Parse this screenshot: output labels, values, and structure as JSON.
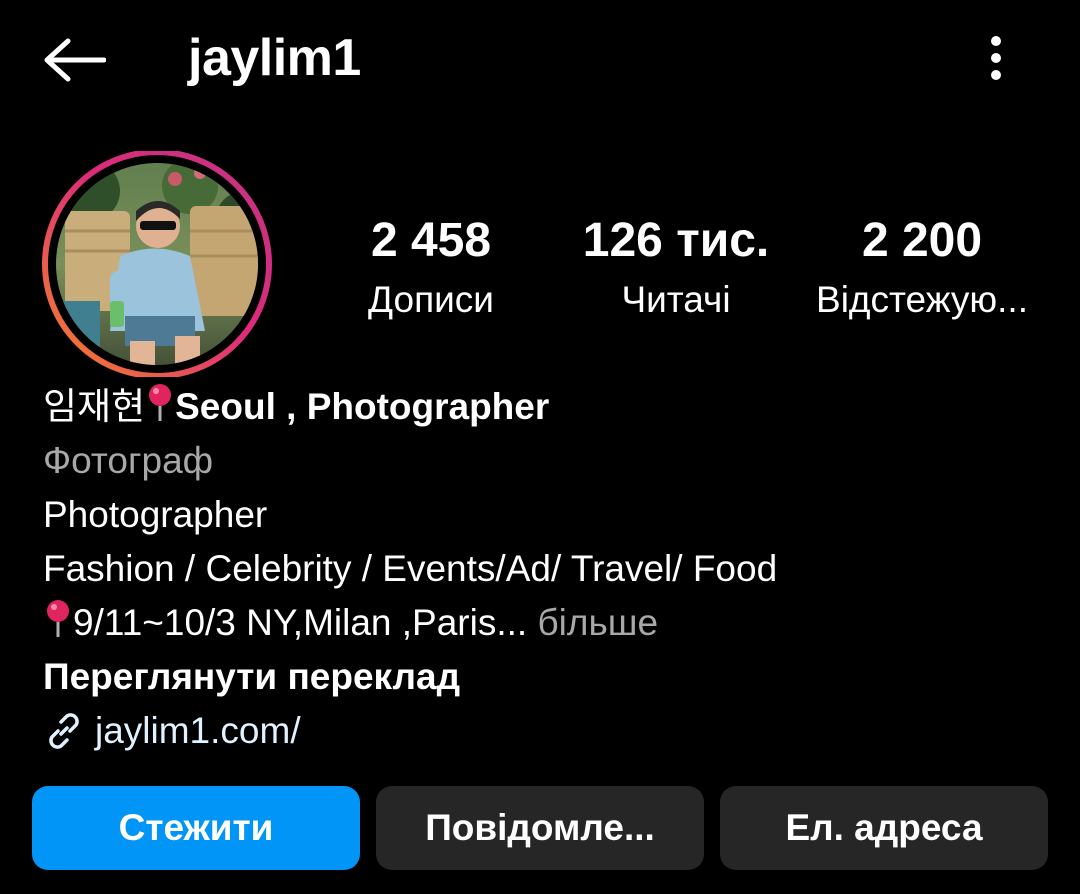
{
  "header": {
    "back_icon": "arrow-left-icon",
    "username": "jaylim1",
    "more_icon": "more-vertical-icon"
  },
  "profile": {
    "avatar_ring_colors": [
      "#f58529",
      "#dd2a7b",
      "#8134af"
    ],
    "stats": [
      {
        "value": "2 458",
        "label": "Дописи"
      },
      {
        "value": "126 тис.",
        "label": "Читачі"
      },
      {
        "value": "2 200",
        "label": "Відстежую..."
      }
    ]
  },
  "bio": {
    "name_korean": "임재현",
    "name_rest": "Seoul , Photographer",
    "category": "Фотограф",
    "line1": "Photographer",
    "line2": "Fashion / Celebrity / Events/Ad/ Travel/ Food",
    "line3": "9/11~10/3 NY,Milan ,Paris...",
    "more_label": "більше",
    "translate_label": "Переглянути переклад",
    "link_icon": "link-icon",
    "link_text": "jaylim1.com/"
  },
  "actions": {
    "follow_label": "Стежити",
    "message_label": "Повідомле...",
    "email_label": "Ел. адреса"
  },
  "colors": {
    "background": "#000000",
    "primary_button": "#0095f6",
    "secondary_button": "#262626",
    "muted_text": "#a8a8a8",
    "link_text": "#e0f1ff"
  }
}
